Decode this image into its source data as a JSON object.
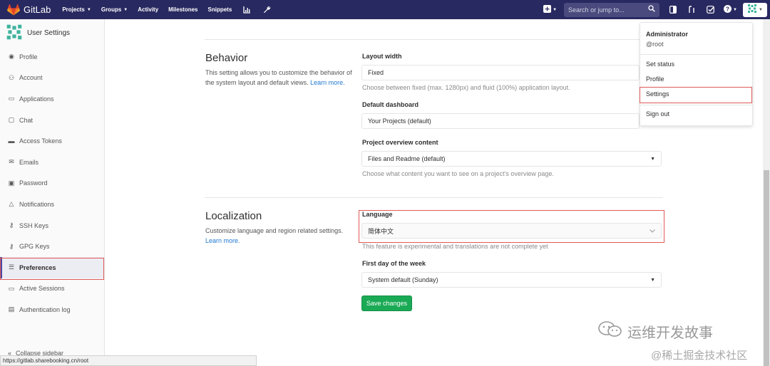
{
  "navbar": {
    "brand": "GitLab",
    "links": [
      {
        "label": "Projects",
        "caret": true
      },
      {
        "label": "Groups",
        "caret": true
      },
      {
        "label": "Activity",
        "caret": false
      },
      {
        "label": "Milestones",
        "caret": false
      },
      {
        "label": "Snippets",
        "caret": false
      }
    ],
    "search_placeholder": "Search or jump to...",
    "colors": {
      "navbar_bg": "#292961",
      "brand_orange": "#fc6d26"
    }
  },
  "sidebar": {
    "title": "User Settings",
    "items": [
      {
        "label": "Profile",
        "icon": "profile-icon"
      },
      {
        "label": "Account",
        "icon": "account-icon"
      },
      {
        "label": "Applications",
        "icon": "applications-icon"
      },
      {
        "label": "Chat",
        "icon": "chat-icon"
      },
      {
        "label": "Access Tokens",
        "icon": "token-icon"
      },
      {
        "label": "Emails",
        "icon": "email-icon"
      },
      {
        "label": "Password",
        "icon": "lock-icon"
      },
      {
        "label": "Notifications",
        "icon": "bell-icon"
      },
      {
        "label": "SSH Keys",
        "icon": "key-icon"
      },
      {
        "label": "GPG Keys",
        "icon": "key-icon"
      },
      {
        "label": "Preferences",
        "icon": "preferences-icon"
      },
      {
        "label": "Active Sessions",
        "icon": "monitor-icon"
      },
      {
        "label": "Authentication log",
        "icon": "log-icon"
      }
    ],
    "active_item": "Preferences",
    "collapse_label": "Collapse sidebar"
  },
  "status_url": "https://gitlab.sharebooking.cn/root",
  "behavior": {
    "title": "Behavior",
    "description": "This setting allows you to customize the behavior of the system layout and default views.",
    "learn_more": "Learn more.",
    "layout_width_label": "Layout width",
    "layout_width_value": "Fixed",
    "layout_width_help": "Choose between fixed (max. 1280px) and fluid (100%) application layout.",
    "default_dashboard_label": "Default dashboard",
    "default_dashboard_value": "Your Projects (default)",
    "project_overview_label": "Project overview content",
    "project_overview_value": "Files and Readme (default)",
    "project_overview_help": "Choose what content you want to see on a project's overview page."
  },
  "localization": {
    "title": "Localization",
    "description": "Customize language and region related settings.",
    "learn_more": "Learn more.",
    "language_label": "Language",
    "language_value": "简体中文",
    "language_help": "This feature is experimental and translations are not complete yet",
    "first_day_label": "First day of the week",
    "first_day_value": "System default (Sunday)"
  },
  "save_button": "Save changes",
  "user_dropdown": {
    "name": "Administrator",
    "handle": "@root",
    "items": [
      "Set status",
      "Profile",
      "Settings",
      "Sign out"
    ]
  },
  "watermarks": {
    "wechat": "运维开发故事",
    "juejin": "@稀土掘金技术社区"
  }
}
